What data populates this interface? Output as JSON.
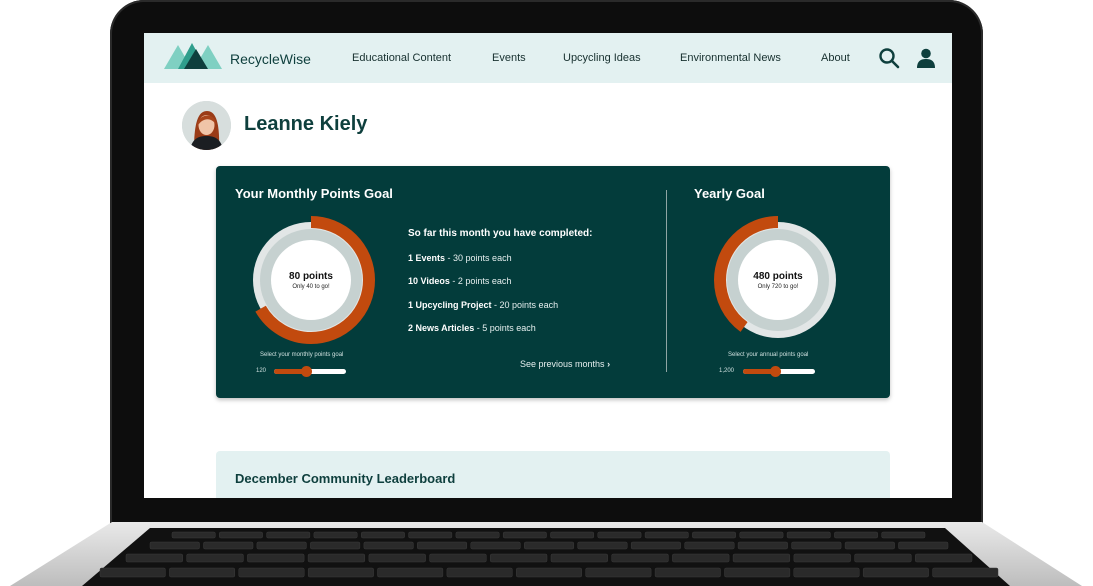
{
  "app": {
    "brand": "RecycleWise"
  },
  "nav": {
    "items": [
      {
        "label": "Educational Content"
      },
      {
        "label": "Events"
      },
      {
        "label": "Upcycling Ideas"
      },
      {
        "label": "Environmental News"
      },
      {
        "label": "About"
      }
    ],
    "icons": [
      "search-icon",
      "user-icon"
    ]
  },
  "profile": {
    "name": "Leanne Kiely"
  },
  "monthly": {
    "title": "Your Monthly Points Goal",
    "points_label": "80 points",
    "remaining": "Only 40 to go!",
    "slider_label": "Select your monthly points goal",
    "slider_value": "120",
    "progress_fraction": 0.667,
    "slider_fraction": 0.45
  },
  "completed": {
    "title": "So far this month you have completed:",
    "items": [
      {
        "name": "1 Events",
        "detail": " - 30 points each"
      },
      {
        "name": "10 Videos",
        "detail": " - 2 points each"
      },
      {
        "name": "1 Upcycling Project",
        "detail": " - 20 points each"
      },
      {
        "name": "2 News Articles",
        "detail": " - 5 points each"
      }
    ],
    "previous_link": "See previous months"
  },
  "yearly": {
    "title": "Yearly Goal",
    "points_label": "480 points",
    "remaining": "Only 720 to go!",
    "slider_label": "Select your annual points goal",
    "slider_value": "1,200",
    "progress_fraction": 0.4,
    "slider_fraction": 0.45
  },
  "leaderboard": {
    "title": "December Community Leaderboard"
  },
  "colors": {
    "accent": "#c24a0e",
    "panel": "#033c3b",
    "navbar": "#e3f1f1",
    "ring_track": "#c6d1d0"
  }
}
